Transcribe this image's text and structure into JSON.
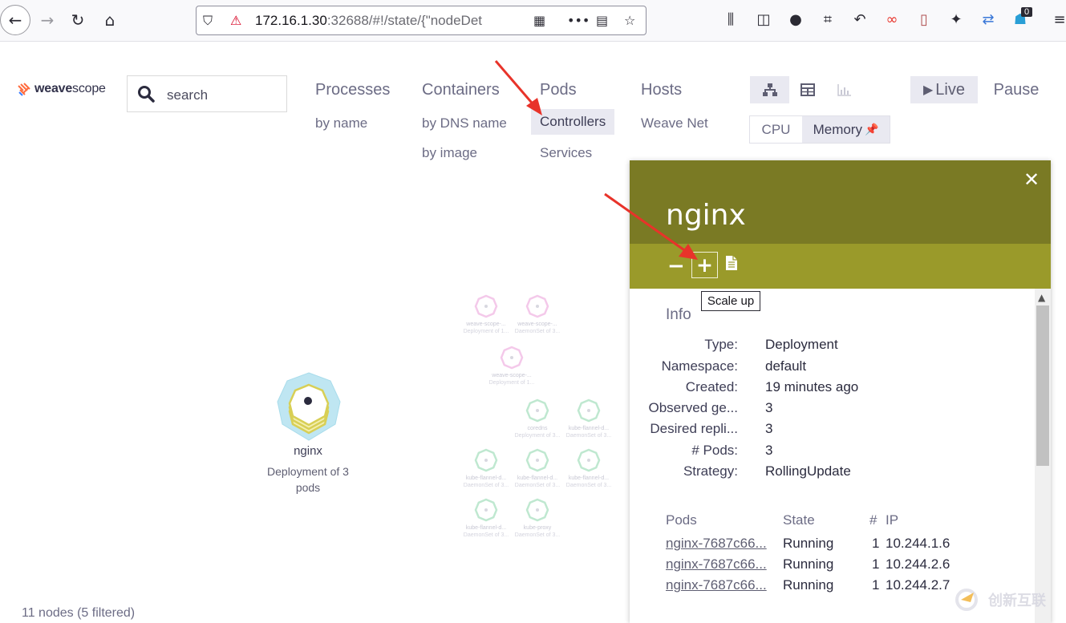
{
  "browser": {
    "url_host": "172.16.1.30",
    "url_rest": ":32688/#!/state/{\"nodeDet",
    "notification_count": "0"
  },
  "app": {
    "logo_bold": "weave",
    "logo_light": "scope",
    "search_placeholder": "search"
  },
  "topologies": [
    {
      "label": "Processes",
      "subs": [
        "by name"
      ]
    },
    {
      "label": "Containers",
      "subs": [
        "by DNS name",
        "by image"
      ]
    },
    {
      "label": "Pods",
      "subs": [
        "Controllers",
        "Services"
      ]
    },
    {
      "label": "Hosts",
      "subs": [
        "Weave Net"
      ]
    }
  ],
  "controls": {
    "live_label": "Live",
    "pause_label": "Pause",
    "metric_cpu": "CPU",
    "metric_memory": "Memory"
  },
  "graph": {
    "selected_label": "nginx",
    "selected_sub": "Deployment of 3 pods",
    "faded_nodes": [
      {
        "label": "weave-scope-...",
        "sub": "Deployment of 1..."
      },
      {
        "label": "weave-scope-...",
        "sub": "DaemonSet of 3..."
      },
      {
        "label": "weave-scope-...",
        "sub": "Deployment of 1..."
      },
      {
        "label": "coredns",
        "sub": "Deployment of 3..."
      },
      {
        "label": "kube-flannel-d...",
        "sub": "DaemonSet of 3..."
      },
      {
        "label": "kube-flannel-d...",
        "sub": "DaemonSet of 3..."
      },
      {
        "label": "kube-flannel-d...",
        "sub": "DaemonSet of 3..."
      },
      {
        "label": "kube-flannel-d...",
        "sub": "DaemonSet of 3..."
      },
      {
        "label": "kube-flannel-d...",
        "sub": "DaemonSet of 3..."
      },
      {
        "label": "kube-proxy",
        "sub": "DaemonSet of 3..."
      }
    ],
    "status": "11 nodes (5 filtered)"
  },
  "details": {
    "title": "nginx",
    "tooltip": "Scale up",
    "info_heading": "Info",
    "info": [
      {
        "label": "Type:",
        "value": "Deployment"
      },
      {
        "label": "Namespace:",
        "value": "default"
      },
      {
        "label": "Created:",
        "value": "19 minutes ago"
      },
      {
        "label": "Observed ge...",
        "value": "3"
      },
      {
        "label": "Desired repli...",
        "value": "3"
      },
      {
        "label": "# Pods:",
        "value": "3"
      },
      {
        "label": "Strategy:",
        "value": "RollingUpdate"
      }
    ],
    "pods_headers": [
      "Pods",
      "State",
      "#",
      "IP"
    ],
    "pods": [
      {
        "name": "nginx-7687c66...",
        "state": "Running",
        "count": "1",
        "ip": "10.244.1.6"
      },
      {
        "name": "nginx-7687c66...",
        "state": "Running",
        "count": "1",
        "ip": "10.244.2.6"
      },
      {
        "name": "nginx-7687c66...",
        "state": "Running",
        "count": "1",
        "ip": "10.244.2.7"
      }
    ]
  },
  "watermark": "创新互联",
  "colors": {
    "panel_header": "#7a7a24",
    "panel_toolbar": "#9a9a2a",
    "arrow": "#e8332a"
  }
}
